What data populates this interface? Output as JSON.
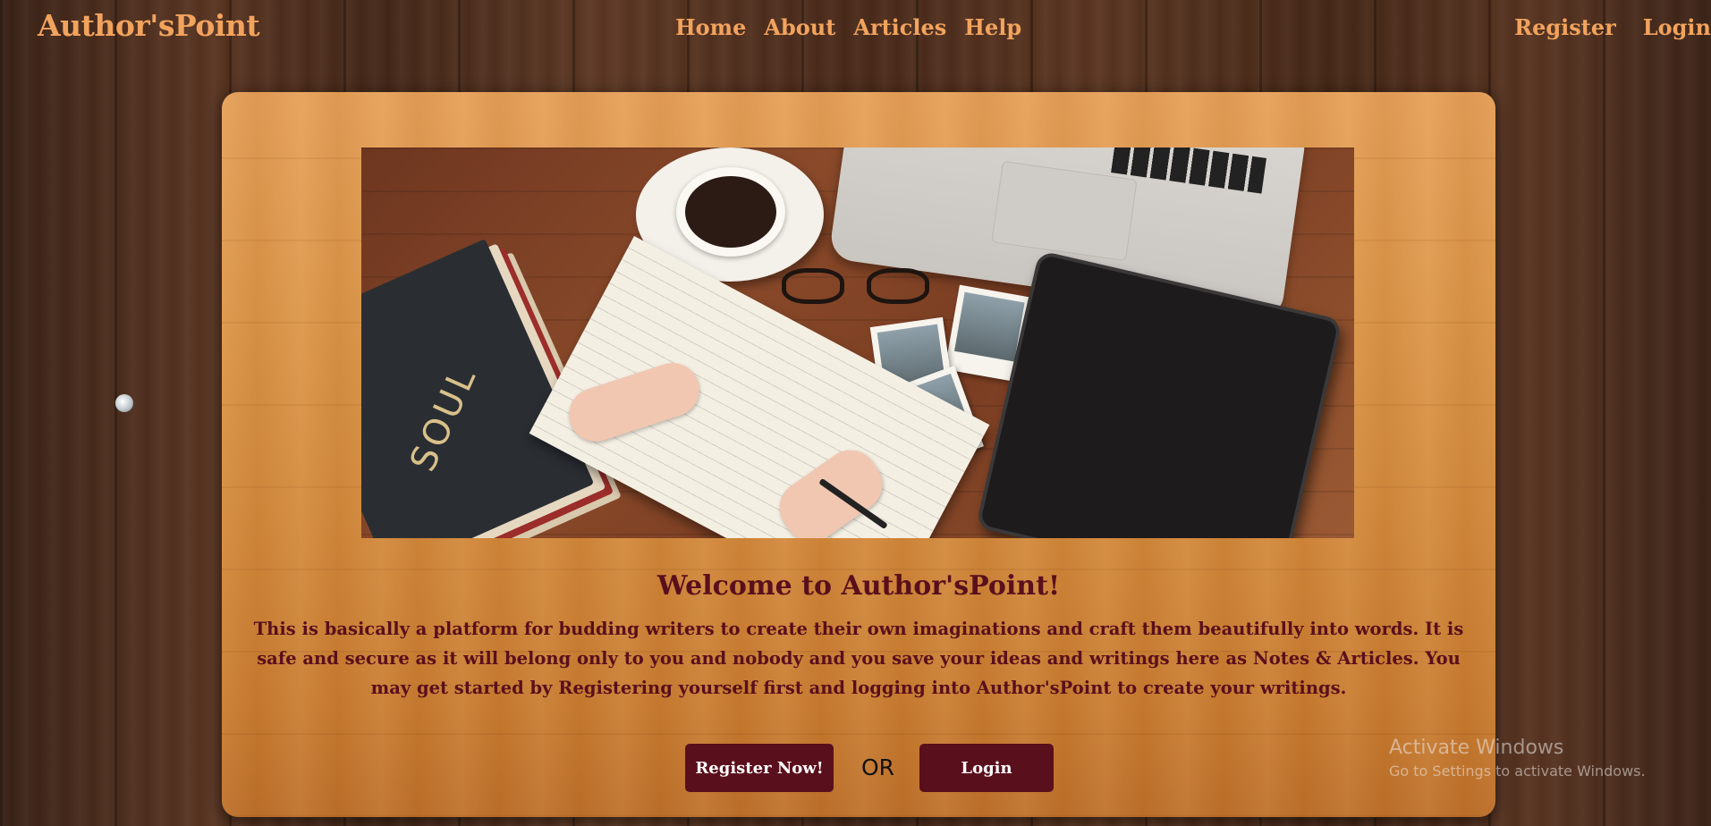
{
  "brand": {
    "name": "Author'sPoint"
  },
  "nav": {
    "center": [
      {
        "label": "Home"
      },
      {
        "label": "About"
      },
      {
        "label": "Articles"
      },
      {
        "label": "Help"
      }
    ],
    "right": [
      {
        "label": "Register"
      },
      {
        "label": "Login"
      }
    ]
  },
  "hero": {
    "book_title": "SOUL"
  },
  "content": {
    "heading": "Welcome to Author'sPoint!",
    "description": "This is basically a platform for budding writers to create their own imaginations and craft them beautifully into words. It is safe and secure as it will belong only to you and nobody and you save your ideas and writings here as Notes & Articles. You may get started by Registering yourself first and logging into Author'sPoint to create your writings."
  },
  "actions": {
    "register_label": "Register Now!",
    "or_label": "OR",
    "login_label": "Login"
  },
  "watermark": {
    "title": "Activate Windows",
    "subtitle": "Go to Settings to activate Windows."
  },
  "colors": {
    "nav_text": "#f2a35d",
    "heading_text": "#5a0f1c",
    "button_bg": "#5a0f1c",
    "button_text": "#ffffff"
  }
}
